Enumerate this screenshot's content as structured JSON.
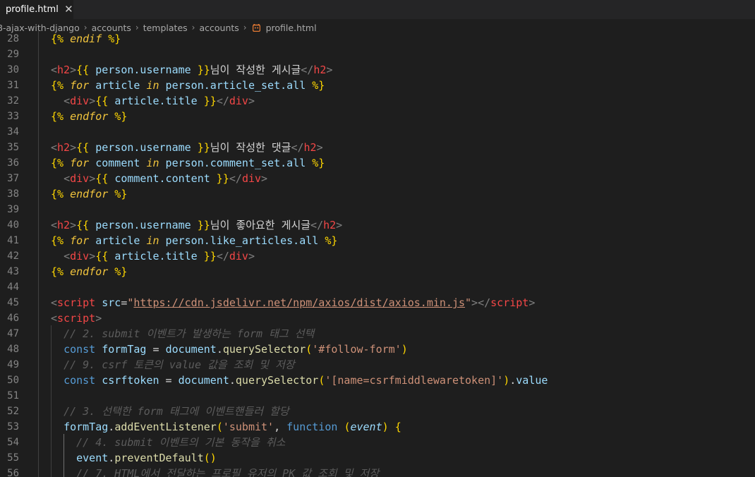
{
  "tab": {
    "title": "profile.html",
    "close": "✕"
  },
  "breadcrumb": [
    {
      "label": "8-ajax-with-django"
    },
    {
      "label": "accounts"
    },
    {
      "label": "templates"
    },
    {
      "label": "accounts"
    },
    {
      "label": "profile.html",
      "icon": "django-template-icon"
    }
  ],
  "editor": {
    "lines": [
      {
        "n": "28",
        "tokens": [
          [
            "{% ",
            "d"
          ],
          [
            "endif",
            "ti"
          ],
          [
            " %}",
            "d"
          ]
        ]
      },
      {
        "n": "29",
        "tokens": []
      },
      {
        "n": "30",
        "tokens": [
          [
            "<",
            "p"
          ],
          [
            "h2",
            "t"
          ],
          [
            ">",
            "p"
          ],
          [
            "{{ ",
            "y"
          ],
          [
            "person.username",
            "v"
          ],
          [
            " }}",
            "y"
          ],
          [
            "님이 작성한 게시글",
            "w"
          ],
          [
            "</",
            "p"
          ],
          [
            "h2",
            "t"
          ],
          [
            ">",
            "p"
          ]
        ]
      },
      {
        "n": "31",
        "tokens": [
          [
            "{% ",
            "d"
          ],
          [
            "for",
            "ti"
          ],
          [
            " article ",
            "v"
          ],
          [
            "in",
            "ti"
          ],
          [
            " person.article_set.all ",
            "v"
          ],
          [
            "%}",
            "d"
          ]
        ]
      },
      {
        "n": "32",
        "tokens": [
          [
            "  ",
            "w"
          ],
          [
            "<",
            "p"
          ],
          [
            "div",
            "t"
          ],
          [
            ">",
            "p"
          ],
          [
            "{{ ",
            "y"
          ],
          [
            "article.title",
            "v"
          ],
          [
            " }}",
            "y"
          ],
          [
            "</",
            "p"
          ],
          [
            "div",
            "t"
          ],
          [
            ">",
            "p"
          ]
        ]
      },
      {
        "n": "33",
        "tokens": [
          [
            "{% ",
            "d"
          ],
          [
            "endfor",
            "ti"
          ],
          [
            " %}",
            "d"
          ]
        ]
      },
      {
        "n": "34",
        "tokens": []
      },
      {
        "n": "35",
        "tokens": [
          [
            "<",
            "p"
          ],
          [
            "h2",
            "t"
          ],
          [
            ">",
            "p"
          ],
          [
            "{{ ",
            "y"
          ],
          [
            "person.username",
            "v"
          ],
          [
            " }}",
            "y"
          ],
          [
            "님이 작성한 댓글",
            "w"
          ],
          [
            "</",
            "p"
          ],
          [
            "h2",
            "t"
          ],
          [
            ">",
            "p"
          ]
        ]
      },
      {
        "n": "36",
        "tokens": [
          [
            "{% ",
            "d"
          ],
          [
            "for",
            "ti"
          ],
          [
            " comment ",
            "v"
          ],
          [
            "in",
            "ti"
          ],
          [
            " person.comment_set.all ",
            "v"
          ],
          [
            "%}",
            "d"
          ]
        ]
      },
      {
        "n": "37",
        "tokens": [
          [
            "  ",
            "w"
          ],
          [
            "<",
            "p"
          ],
          [
            "div",
            "t"
          ],
          [
            ">",
            "p"
          ],
          [
            "{{ ",
            "y"
          ],
          [
            "comment.content",
            "v"
          ],
          [
            " }}",
            "y"
          ],
          [
            "</",
            "p"
          ],
          [
            "div",
            "t"
          ],
          [
            ">",
            "p"
          ]
        ]
      },
      {
        "n": "38",
        "tokens": [
          [
            "{% ",
            "d"
          ],
          [
            "endfor",
            "ti"
          ],
          [
            " %}",
            "d"
          ]
        ]
      },
      {
        "n": "39",
        "tokens": []
      },
      {
        "n": "40",
        "tokens": [
          [
            "<",
            "p"
          ],
          [
            "h2",
            "t"
          ],
          [
            ">",
            "p"
          ],
          [
            "{{ ",
            "y"
          ],
          [
            "person.username",
            "v"
          ],
          [
            " }}",
            "y"
          ],
          [
            "님이 좋아요한 게시글",
            "w"
          ],
          [
            "</",
            "p"
          ],
          [
            "h2",
            "t"
          ],
          [
            ">",
            "p"
          ]
        ]
      },
      {
        "n": "41",
        "tokens": [
          [
            "{% ",
            "d"
          ],
          [
            "for",
            "ti"
          ],
          [
            " article ",
            "v"
          ],
          [
            "in",
            "ti"
          ],
          [
            " person.like_articles.all ",
            "v"
          ],
          [
            "%}",
            "d"
          ]
        ]
      },
      {
        "n": "42",
        "tokens": [
          [
            "  ",
            "w"
          ],
          [
            "<",
            "p"
          ],
          [
            "div",
            "t"
          ],
          [
            ">",
            "p"
          ],
          [
            "{{ ",
            "y"
          ],
          [
            "article.title",
            "v"
          ],
          [
            " }}",
            "y"
          ],
          [
            "</",
            "p"
          ],
          [
            "div",
            "t"
          ],
          [
            ">",
            "p"
          ]
        ]
      },
      {
        "n": "43",
        "tokens": [
          [
            "{% ",
            "d"
          ],
          [
            "endfor",
            "ti"
          ],
          [
            " %}",
            "d"
          ]
        ]
      },
      {
        "n": "44",
        "tokens": []
      },
      {
        "n": "45",
        "tokens": [
          [
            "<",
            "p"
          ],
          [
            "script",
            "t"
          ],
          [
            " ",
            "w"
          ],
          [
            "src",
            "a"
          ],
          [
            "=",
            "w"
          ],
          [
            "\"",
            "s"
          ],
          [
            "https://cdn.jsdelivr.net/npm/axios/dist/axios.min.js",
            "u"
          ],
          [
            "\"",
            "s"
          ],
          [
            "></",
            "p"
          ],
          [
            "script",
            "t"
          ],
          [
            ">",
            "p"
          ]
        ]
      },
      {
        "n": "46",
        "tokens": [
          [
            "<",
            "p"
          ],
          [
            "script",
            "t"
          ],
          [
            ">",
            "p"
          ]
        ]
      },
      {
        "n": "47",
        "tokens": [
          [
            "  ",
            "w"
          ],
          [
            "// 2. submit 이벤트가 발생하는 form 태그 선택",
            "c"
          ]
        ]
      },
      {
        "n": "48",
        "tokens": [
          [
            "  ",
            "w"
          ],
          [
            "const",
            "k"
          ],
          [
            " ",
            "w"
          ],
          [
            "formTag",
            "v"
          ],
          [
            " = ",
            "w"
          ],
          [
            "document",
            "v"
          ],
          [
            ".",
            "w"
          ],
          [
            "querySelector",
            "f"
          ],
          [
            "(",
            "pr"
          ],
          [
            "'#follow-form'",
            "s"
          ],
          [
            ")",
            "pr"
          ]
        ]
      },
      {
        "n": "49",
        "tokens": [
          [
            "  ",
            "w"
          ],
          [
            "// 9. csrf 토큰의 value 값을 조회 및 저장",
            "c"
          ]
        ]
      },
      {
        "n": "50",
        "tokens": [
          [
            "  ",
            "w"
          ],
          [
            "const",
            "k"
          ],
          [
            " ",
            "w"
          ],
          [
            "csrftoken",
            "v"
          ],
          [
            " = ",
            "w"
          ],
          [
            "document",
            "v"
          ],
          [
            ".",
            "w"
          ],
          [
            "querySelector",
            "f"
          ],
          [
            "(",
            "pr"
          ],
          [
            "'[name=csrfmiddlewaretoken]'",
            "s"
          ],
          [
            ")",
            "pr"
          ],
          [
            ".",
            "w"
          ],
          [
            "value",
            "v"
          ]
        ]
      },
      {
        "n": "51",
        "tokens": []
      },
      {
        "n": "52",
        "tokens": [
          [
            "  ",
            "w"
          ],
          [
            "// 3. 선택한 form 태그에 이벤트핸들러 할당",
            "c"
          ]
        ]
      },
      {
        "n": "53",
        "tokens": [
          [
            "  ",
            "w"
          ],
          [
            "formTag",
            "v"
          ],
          [
            ".",
            "w"
          ],
          [
            "addEventListener",
            "f"
          ],
          [
            "(",
            "pr"
          ],
          [
            "'submit'",
            "s"
          ],
          [
            ", ",
            "w"
          ],
          [
            "function",
            "k"
          ],
          [
            " ",
            "w"
          ],
          [
            "(",
            "pr"
          ],
          [
            "event",
            "pm"
          ],
          [
            ")",
            "pr"
          ],
          [
            " ",
            "w"
          ],
          [
            "{",
            "pr"
          ]
        ]
      },
      {
        "n": "54",
        "tokens": [
          [
            "    ",
            "w"
          ],
          [
            "// 4. submit 이벤트의 기본 동작을 취소",
            "c"
          ]
        ]
      },
      {
        "n": "55",
        "tokens": [
          [
            "    ",
            "w"
          ],
          [
            "event",
            "v"
          ],
          [
            ".",
            "w"
          ],
          [
            "preventDefault",
            "f"
          ],
          [
            "()",
            "pr"
          ]
        ]
      },
      {
        "n": "56",
        "tokens": [
          [
            "    ",
            "w"
          ],
          [
            "// 7. HTML에서 전달하는 프로필 유저의 PK 값 조회 및 저장",
            "c"
          ]
        ]
      }
    ]
  }
}
